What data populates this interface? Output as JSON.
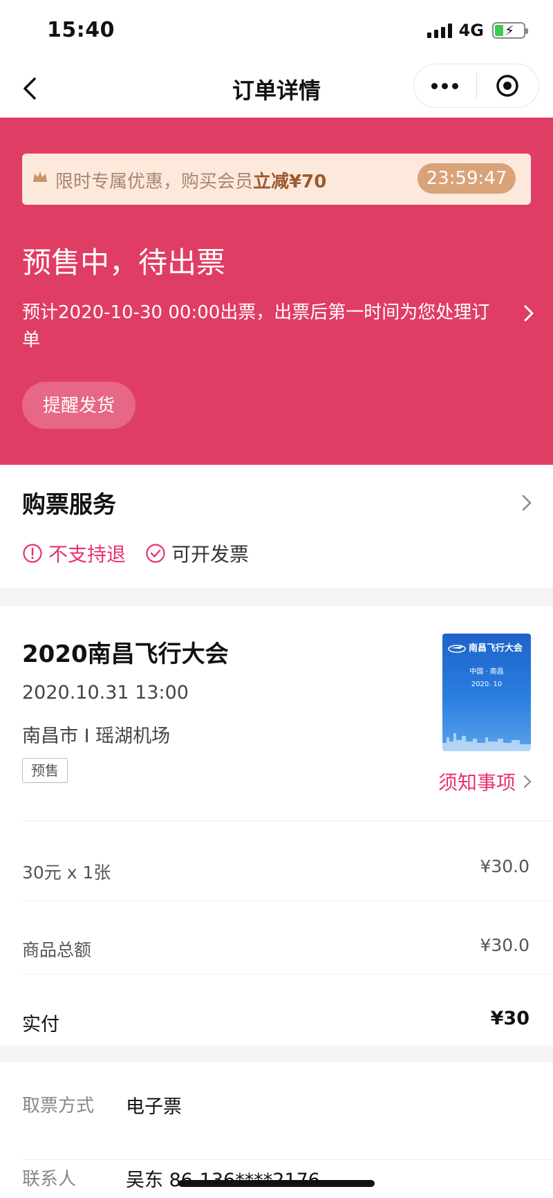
{
  "status_bar": {
    "time": "15:40",
    "network": "4G"
  },
  "nav": {
    "title": "订单详情"
  },
  "promo": {
    "text": "限时专属优惠，购买会员",
    "highlight": "立减¥70",
    "timer": "23:59:47"
  },
  "order_status": {
    "title": "预售中，待出票",
    "description": "预计2020-10-30 00:00出票，出票后第一时间为您处理订单",
    "remind_button": "提醒发货"
  },
  "service": {
    "title": "购票服务",
    "tags": [
      {
        "label": "不支持退",
        "icon": "exclamation-circle-icon",
        "color": "#e8326a"
      },
      {
        "label": "可开发票",
        "icon": "check-circle-icon",
        "color": "#e8326a"
      }
    ]
  },
  "event": {
    "name": "2020南昌飞行大会",
    "time": "2020.10.31 13:00",
    "venue": "南昌市 I 瑶湖机场",
    "badge": "预售",
    "notice_link": "须知事项",
    "poster": {
      "title": "南昌飞行大会",
      "subtitle": "中国 · 南昌",
      "date": "2020. 10"
    }
  },
  "price_rows": [
    {
      "label": "30元 x 1张",
      "value": "¥30.0"
    },
    {
      "label": "商品总额",
      "value": "¥30.0"
    },
    {
      "label": "实付",
      "value": "¥30"
    }
  ],
  "delivery": {
    "method_label": "取票方式",
    "method_value": "电子票",
    "contact_label": "联系人",
    "contact_value": "吴东 86-136****2176"
  },
  "colors": {
    "header_bg": "#e03d64",
    "accent": "#e8326a",
    "promo_bg": "#fde9dc",
    "timer_bg": "#d9a37a"
  }
}
